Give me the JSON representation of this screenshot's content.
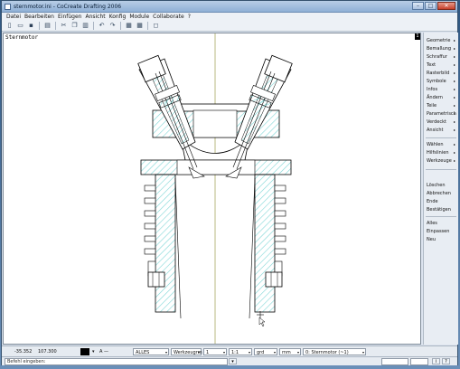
{
  "window": {
    "title": "sternmotor.ini - CoCreate Drafting 2006",
    "controls": {
      "minimize": "–",
      "maximize": "□",
      "close": "✕"
    }
  },
  "menubar": {
    "items": [
      "Datei",
      "Bearbeiten",
      "Einfügen",
      "Ansicht",
      "Konfig",
      "Module",
      "Collaborate",
      "?"
    ]
  },
  "toolbar": {
    "buttons": [
      {
        "name": "new-file-icon",
        "glyph": "▯"
      },
      {
        "name": "open-folder-icon",
        "glyph": "▭"
      },
      {
        "name": "save-icon",
        "glyph": "▪"
      },
      {
        "name": "print-icon",
        "glyph": "▤"
      },
      {
        "name": "cut-icon",
        "glyph": "✂"
      },
      {
        "name": "copy-icon",
        "glyph": "❐"
      },
      {
        "name": "paste-icon",
        "glyph": "▥"
      },
      {
        "name": "undo-icon",
        "glyph": "↶"
      },
      {
        "name": "redo-icon",
        "glyph": "↷"
      },
      {
        "name": "grid-icon",
        "glyph": "▦"
      },
      {
        "name": "layout-icon",
        "glyph": "▦"
      },
      {
        "name": "zoom-icon",
        "glyph": "◻"
      }
    ]
  },
  "canvas": {
    "drawing_name": "Sternmotor",
    "corner_marker": "1",
    "colors": {
      "lines": "#000000",
      "hatch": "#7fd6d6",
      "centerline": "#8a8a2a",
      "background": "#ffffff"
    }
  },
  "sidebar": {
    "group1": [
      {
        "label": "Geometrie",
        "arrow": "▸"
      },
      {
        "label": "Bemaßung",
        "arrow": "▸"
      },
      {
        "label": "Schraffur",
        "arrow": "▸"
      },
      {
        "label": "Text",
        "arrow": "▸"
      },
      {
        "label": "Rasterbild",
        "arrow": "▸"
      },
      {
        "label": "Symbole",
        "arrow": "▸"
      },
      {
        "label": "Infos",
        "arrow": "▸"
      },
      {
        "label": "Ändern",
        "arrow": "▸"
      },
      {
        "label": "Teile",
        "arrow": "▸"
      },
      {
        "label": "Parametrisch",
        "arrow": "▸"
      },
      {
        "label": "Verdeckt",
        "arrow": "▸"
      },
      {
        "label": "Ansicht",
        "arrow": "▸"
      }
    ],
    "group2": [
      {
        "label": "Wählen",
        "arrow": "▸"
      },
      {
        "label": "Hilfslinien",
        "arrow": "▸"
      },
      {
        "label": "Werkzeuge",
        "arrow": "▸"
      }
    ],
    "group3": [
      "Löschen",
      "Abbrechen",
      "Ende",
      "Bestätigen"
    ],
    "group4": [
      "Alles",
      "Einpassen",
      "Neu"
    ]
  },
  "statusbar": {
    "coord_x": "-35.352",
    "coord_y": "107.300",
    "color_label": "",
    "line_style": "—",
    "line_type_label": "A",
    "layer_filter": "ALLES",
    "workspace": "Werkzeugrm",
    "pen": "1",
    "scale": "1:1",
    "angle_unit": "grd",
    "length_unit": "mm",
    "part": "0: Sternmotor (~1)"
  },
  "commandbar": {
    "prompt": "Befehl eingeben:"
  }
}
